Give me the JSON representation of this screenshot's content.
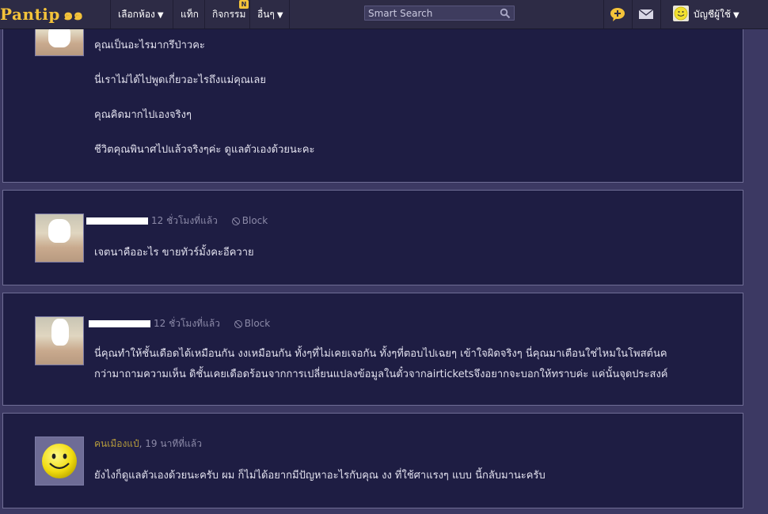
{
  "navbar": {
    "logo_text": "Pantip",
    "logo_mark": "๑๑",
    "menu_rooms": "เลือกห้อง",
    "menu_tags": "แท็ก",
    "menu_activities": "กิจกรรม",
    "activities_badge": "N",
    "menu_more": "อื่นๆ",
    "search_placeholder": "Smart Search",
    "account_label": "บัญชีผู้ใช้"
  },
  "comments": [
    {
      "lines": [
        "คุณเป็นอะไรมากรึป่าวคะ",
        "นี่เราไม่ได้ไปพูดเกี่ยวอะไรถึงแม่คุณเลย",
        "คุณคิดมากไปเองจริงๆ",
        "ชีวิตคุณพินาศไปแล้วจริงๆค่ะ ดูแลตัวเองด้วยนะคะ"
      ]
    },
    {
      "time": "12 ชั่วโมงที่แล้ว",
      "block": "Block",
      "lines": [
        "เจตนาคืออะไร ขายทัวร์มั้งคะอีควาย"
      ]
    },
    {
      "time": "12 ชั่วโมงที่แล้ว",
      "block": "Block",
      "lines": [
        "นี่คุณทำให้ชั้นเดือดได้เหมือนกัน งงเหมือนกัน ทั้งๆที่ไม่เคยเจอกัน ทั้งๆที่ตอบไปเฉยๆ เข้าใจผิดจริงๆ นี่คุณมาเตือนใช่ไหมในโพสต์นค",
        "กว่ามาถามความเห็น ดิชั้นเคยเดือดร้อนจากการเปลี่ยนแปลงข้อมูลในตั๋วจากairticketsจึงอยากจะบอกให้ทราบค่ะ แค่นั้นจุดประสงค์"
      ]
    },
    {
      "name": "คนเมืองแป๋",
      "time": ", 19 นาทีที่แล้ว",
      "lines": [
        "ยังไงก็ดูแลตัวเองด้วยนะครับ ผม ก็ไม่ได้อยากมีปัญหาอะไรกับคุณ งง ที่ใช้ศาแรงๆ แบบ นี้กลับมานะครับ"
      ]
    }
  ]
}
